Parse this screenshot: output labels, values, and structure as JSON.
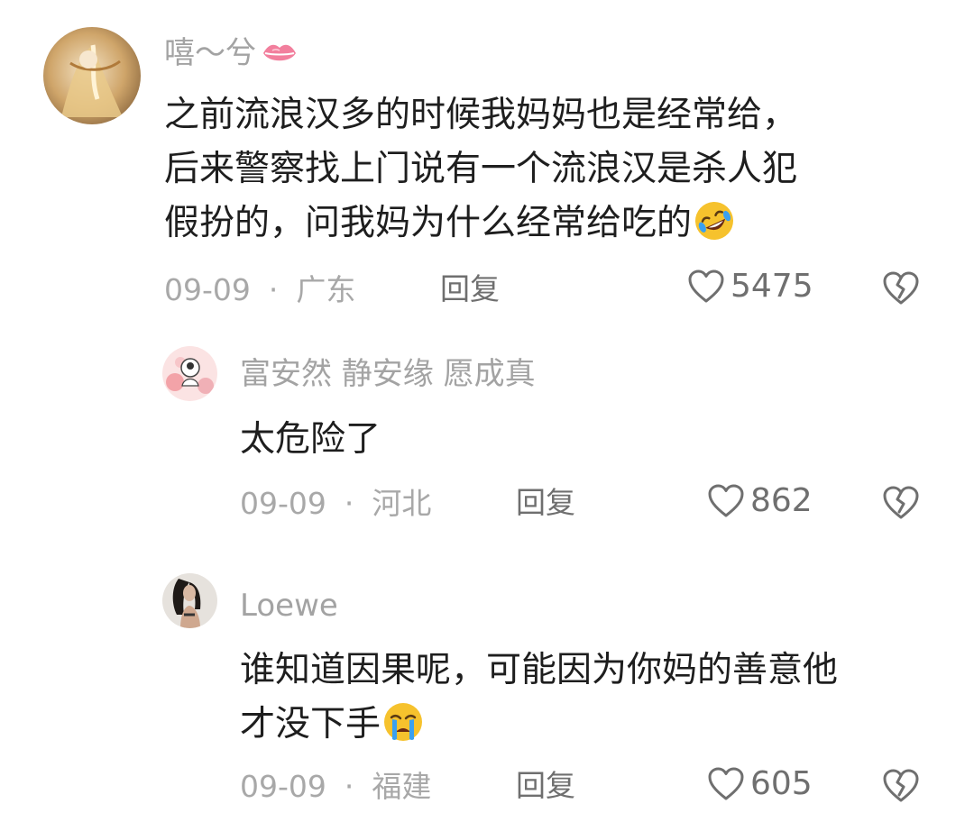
{
  "comments": [
    {
      "username": "嘻～兮",
      "text_lines": [
        "之前流浪汉多的时候我妈妈也是经常给，",
        "后来警察找上门说有一个流浪汉是杀人犯",
        "假扮的，问我妈为什么经常给吃的"
      ],
      "trailing_emoji": "rofl-emoji",
      "name_icon": "lips-icon",
      "date": "09-09",
      "location": "广东",
      "reply_label": "回复",
      "likes": "5475"
    },
    {
      "username": "富安然 静安缘 愿成真",
      "text_lines": [
        "太危险了"
      ],
      "date": "09-09",
      "location": "河北",
      "reply_label": "回复",
      "likes": "862"
    },
    {
      "username": "Loewe",
      "text_lines": [
        "谁知道因果呢，可能因为你妈的善意他",
        "才没下手"
      ],
      "trailing_emoji": "crying-emoji",
      "date": "09-09",
      "location": "福建",
      "reply_label": "回复",
      "likes": "605"
    }
  ],
  "separator": "·",
  "colors": {
    "text_primary": "#1e1e1e",
    "text_secondary": "#a8a8a8",
    "action_text": "#6f6f6f",
    "emoji_yellow": "#f6c22d",
    "tear_blue": "#3aa0f0"
  }
}
